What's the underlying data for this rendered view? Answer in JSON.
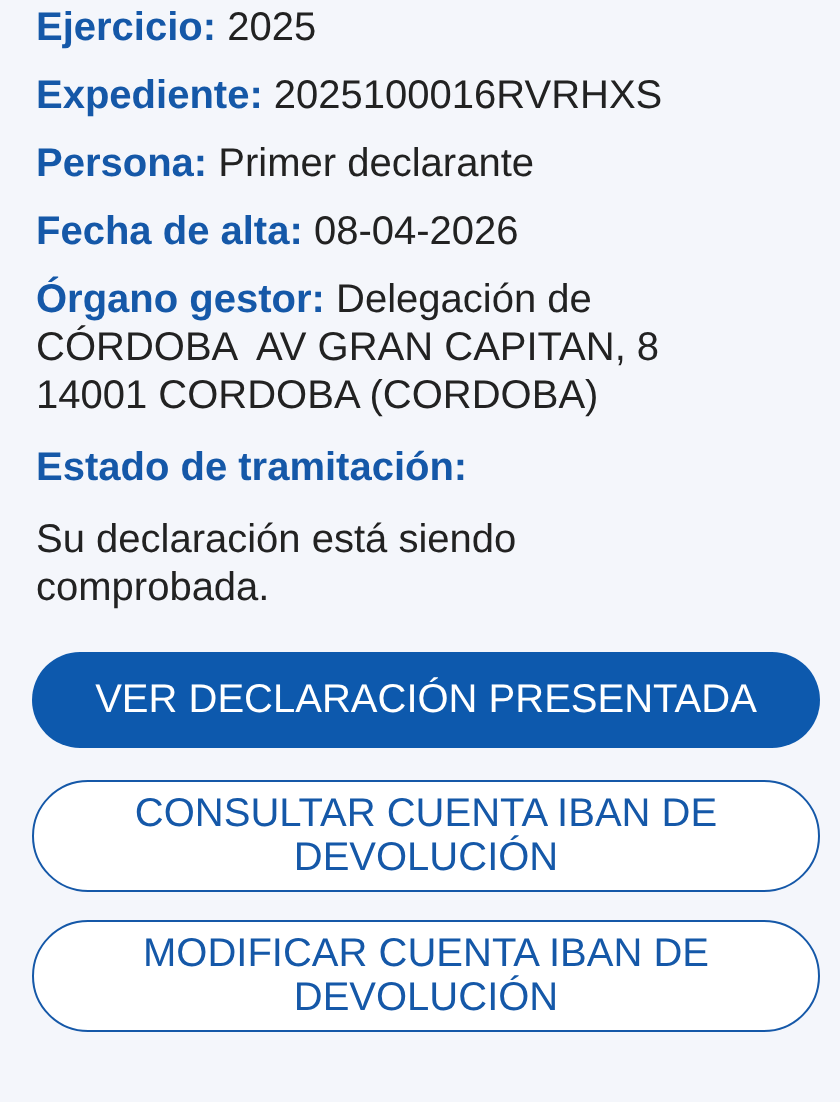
{
  "fields": [
    {
      "label": "Ejercicio:",
      "value": "2025"
    },
    {
      "label": "Expediente:",
      "value": "2025100016RVRHXS"
    },
    {
      "label": "Persona:",
      "value": "Primer declarante"
    },
    {
      "label": "Fecha de alta:",
      "value": "08-04-2026"
    },
    {
      "label": "Órgano gestor:",
      "value": "Delegación de\nCÓRDOBA  AV GRAN CAPITAN, 8\n14001 CORDOBA (CORDOBA)"
    }
  ],
  "status": {
    "heading": "Estado de tramitación:",
    "text": "Su declaración está siendo comprobada."
  },
  "buttons": [
    {
      "label": "VER DECLARACIÓN PRESENTADA",
      "kind": "filled"
    },
    {
      "label": "CONSULTAR CUENTA IBAN DE DEVOLUCIÓN",
      "kind": "outlined"
    },
    {
      "label": "MODIFICAR CUENTA IBAN DE DEVOLUCIÓN",
      "kind": "outlined"
    }
  ]
}
